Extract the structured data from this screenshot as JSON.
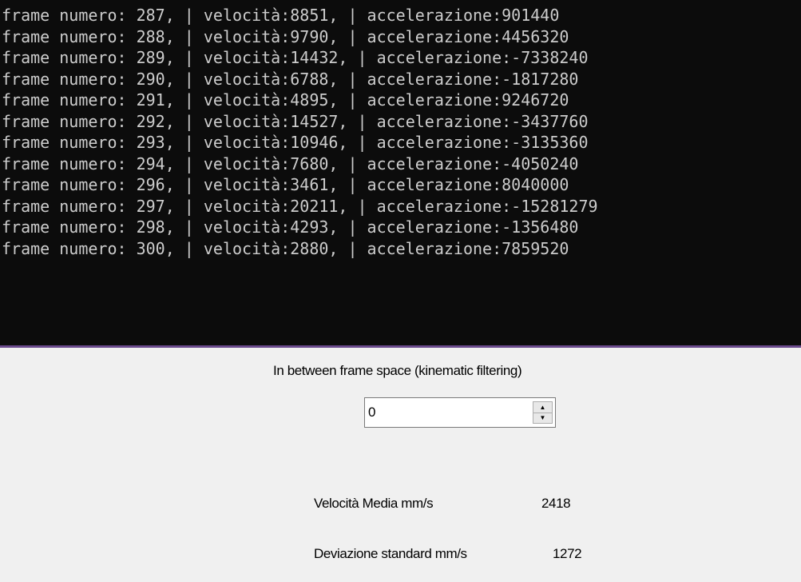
{
  "console": {
    "lines": [
      "frame numero: 287, | velocità:8851, | accelerazione:901440",
      "frame numero: 288, | velocità:9790, | accelerazione:4456320",
      "frame numero: 289, | velocità:14432, | accelerazione:-7338240",
      "frame numero: 290, | velocità:6788, | accelerazione:-1817280",
      "frame numero: 291, | velocità:4895, | accelerazione:9246720",
      "frame numero: 292, | velocità:14527, | accelerazione:-3437760",
      "frame numero: 293, | velocità:10946, | accelerazione:-3135360",
      "frame numero: 294, | velocità:7680, | accelerazione:-4050240",
      "frame numero: 296, | velocità:3461, | accelerazione:8040000",
      "frame numero: 297, | velocità:20211, | accelerazione:-15281279",
      "frame numero: 298, | velocità:4293, | accelerazione:-1356480",
      "frame numero: 300, | velocità:2880, | accelerazione:7859520"
    ],
    "text_color": "#cccccc",
    "background": "#0c0c0c"
  },
  "form": {
    "spacing_label": "In between frame space (kinematic filtering)",
    "spacing_value": "0",
    "spin_up_icon": "triangle-up",
    "spin_down_icon": "triangle-down",
    "velocity_label": "Velocità Media mm/s",
    "velocity_value": "2418",
    "stddev_label": "Deviazione standard mm/s",
    "stddev_value": "1272"
  }
}
